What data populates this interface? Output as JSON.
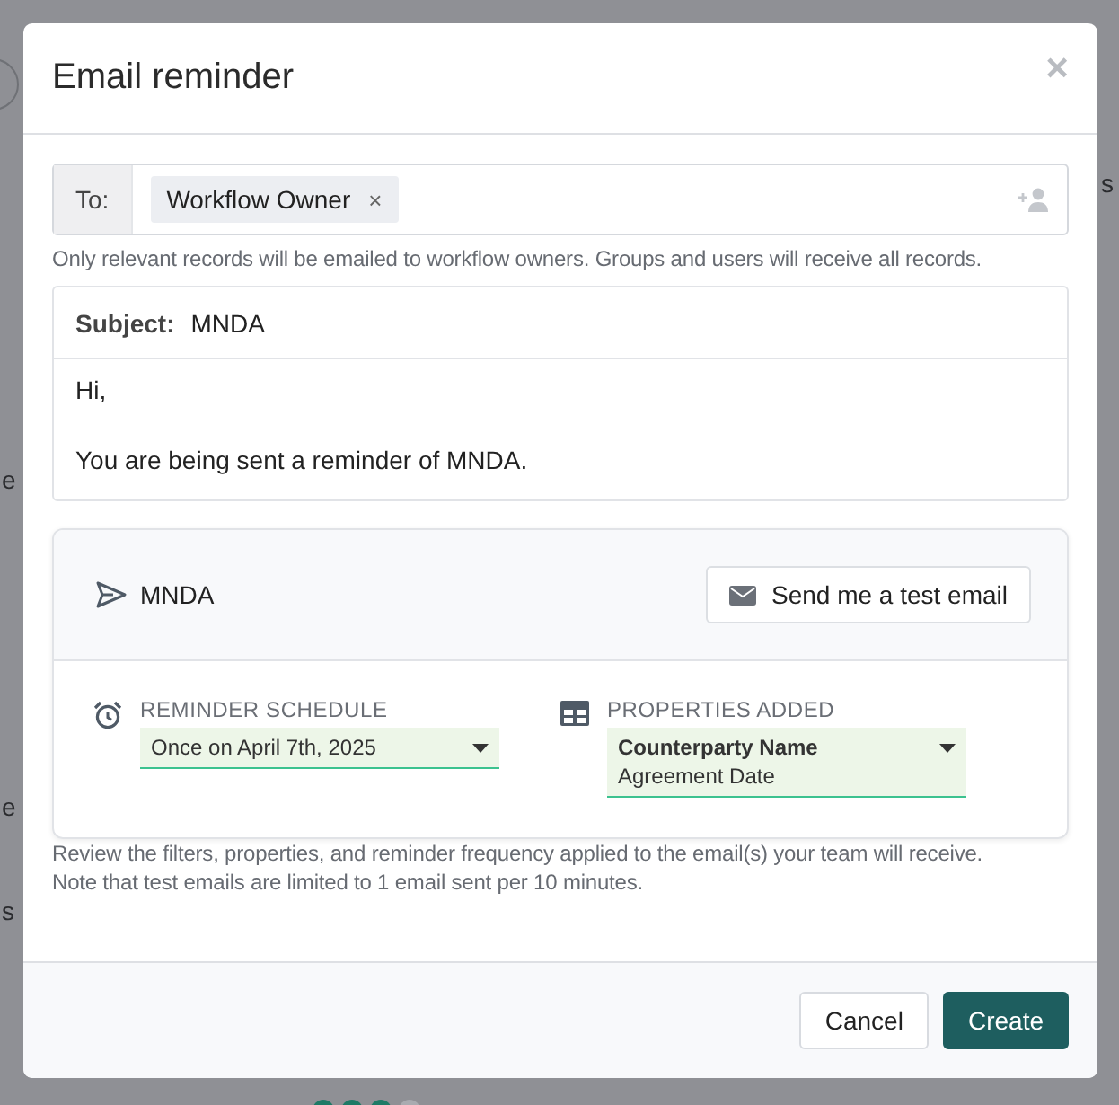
{
  "background": {
    "fragments": [
      "s",
      "e",
      "e",
      "s"
    ]
  },
  "dialog": {
    "title": "Email reminder",
    "close": "×"
  },
  "recipients": {
    "label": "To:",
    "chips": [
      {
        "label": "Workflow Owner",
        "remove": "×"
      }
    ]
  },
  "recipients_hint": "Only relevant records will be emailed to workflow owners. Groups and users will receive all records.",
  "email": {
    "subject_label": "Subject:",
    "subject": "MNDA",
    "body": [
      "Hi,",
      "You are being sent a reminder of MNDA."
    ]
  },
  "preview": {
    "name": "MNDA",
    "test_button": "Send me a test email",
    "schedule": {
      "label": "REMINDER SCHEDULE",
      "value": "Once on April 7th, 2025"
    },
    "properties": {
      "label": "PROPERTIES ADDED",
      "items": [
        {
          "label": "Counterparty Name",
          "primary": true
        },
        {
          "label": "Agreement Date",
          "primary": false
        }
      ]
    }
  },
  "note": [
    "Review the filters, properties, and reminder frequency applied to the email(s) your team will receive.",
    "Note that test emails are limited to 1 email sent per 10 minutes."
  ],
  "buttons": [
    {
      "label": "Cancel",
      "kind": "secondary"
    },
    {
      "label": "Create",
      "kind": "primary"
    }
  ]
}
